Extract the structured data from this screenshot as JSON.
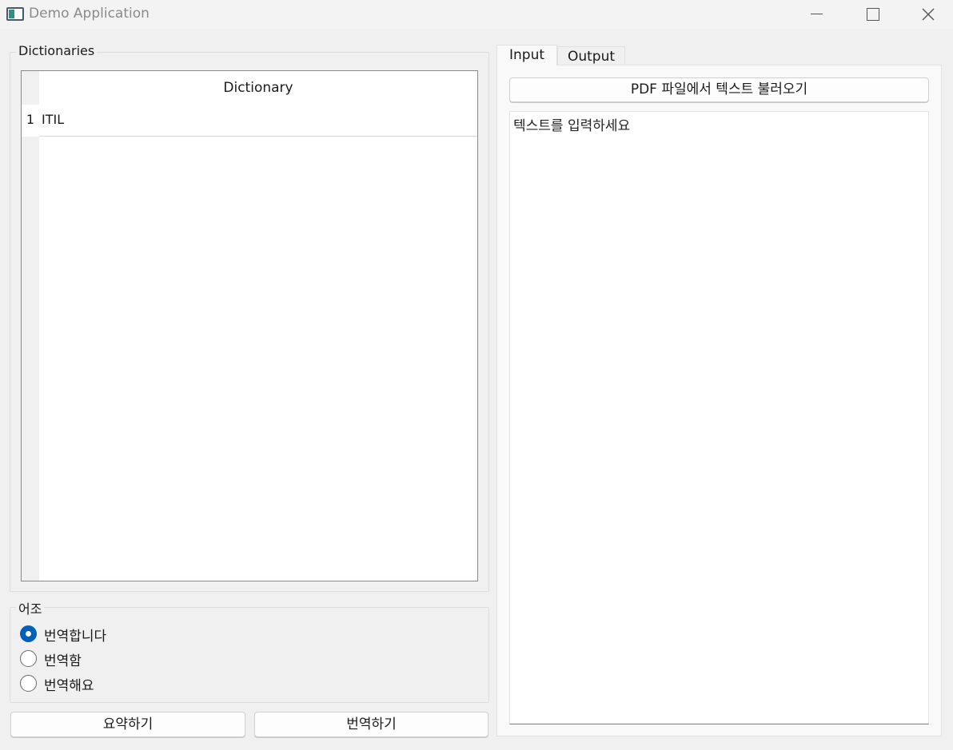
{
  "window": {
    "title": "Demo Application"
  },
  "dictionaries": {
    "group_title": "Dictionaries",
    "column_header": "Dictionary",
    "rows": [
      {
        "num": "1",
        "value": "ITIL"
      }
    ]
  },
  "tone": {
    "group_title": "어조",
    "options": [
      {
        "label": "번역합니다",
        "checked": true
      },
      {
        "label": "번역함",
        "checked": false
      },
      {
        "label": "번역해요",
        "checked": false
      }
    ]
  },
  "actions": {
    "summarize_label": "요약하기",
    "translate_label": "번역하기"
  },
  "tabs": [
    {
      "label": "Input",
      "active": true
    },
    {
      "label": "Output",
      "active": false
    }
  ],
  "input_tab": {
    "load_pdf_label": "PDF 파일에서 텍스트 불러오기",
    "text_placeholder": "텍스트를 입력하세요"
  },
  "colors": {
    "accent": "#005fb8",
    "background": "#f0f0f0"
  }
}
